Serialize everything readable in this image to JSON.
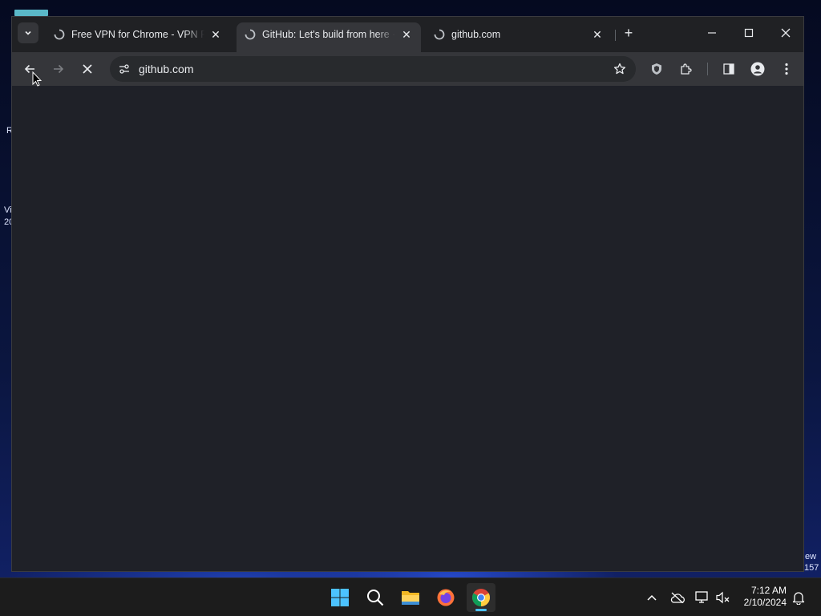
{
  "desktop": {
    "fragments": [
      {
        "text": "R"
      },
      {
        "text": "Vi"
      },
      {
        "text": "20"
      },
      {
        "text": "ew"
      },
      {
        "text": "157"
      }
    ]
  },
  "browser": {
    "tabs": [
      {
        "title": "Free VPN for Chrome - VPN Proxy VeePN",
        "active": false,
        "icon": "vpn-loading-icon"
      },
      {
        "title": "GitHub: Let's build from here · GitHub",
        "active": true,
        "icon": "loading-spinner-icon"
      },
      {
        "title": "github.com",
        "active": false,
        "icon": "loading-spinner-icon"
      }
    ],
    "new_tab_symbol": "+",
    "omnibox": {
      "url": "github.com"
    },
    "toolbar_icons": [
      "back-icon",
      "forward-icon",
      "stop-icon",
      "site-info-icon",
      "bookmark-star-icon",
      "vpn-shield-icon",
      "extensions-icon",
      "side-panel-icon",
      "profile-icon",
      "menu-icon"
    ]
  },
  "taskbar": {
    "apps": [
      "start-icon",
      "search-icon",
      "file-explorer-icon",
      "firefox-icon",
      "chrome-icon"
    ],
    "active_app": "chrome-icon",
    "clock": {
      "time": "7:12 AM",
      "date": "2/10/2024"
    },
    "accent_color": "#4cc2ff"
  }
}
